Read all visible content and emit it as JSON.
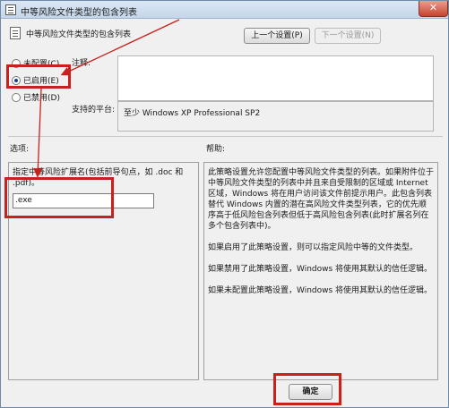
{
  "window": {
    "title": "中等风险文件类型的包含列表",
    "close": "✕"
  },
  "header": {
    "title": "中等风险文件类型的包含列表",
    "prev_button": "上一个设置(P)",
    "next_button": "下一个设置(N)"
  },
  "state_options": [
    {
      "label": "未配置(C)",
      "checked": false
    },
    {
      "label": "已启用(E)",
      "checked": true
    },
    {
      "label": "已禁用(D)",
      "checked": false
    }
  ],
  "comment_label": "注释:",
  "platform": {
    "label": "支持的平台:",
    "value": "至少 Windows XP Professional SP2"
  },
  "options": {
    "label": "选项:",
    "description": "指定中等风险扩展名(包括前导句点，如 .doc 和 .pdf)。",
    "extension_value": ".exe"
  },
  "help": {
    "label": "帮助:",
    "paragraphs": [
      "此策略设置允许您配置中等风险文件类型的列表。如果附件位于中等风险文件类型的列表中并且来自受限制的区域或 Internet 区域，Windows 将在用户访问该文件前提示用户。此包含列表替代 Windows 内置的潜在高风险文件类型列表，它的优先顺序高于低风险包含列表但低于高风险包含列表(此时扩展名列在多个包含列表中)。",
      "如果启用了此策略设置，则可以指定风险中等的文件类型。",
      "如果禁用了此策略设置，Windows 将使用其默认的信任逻辑。",
      "如果未配置此策略设置，Windows 将使用其默认的信任逻辑。"
    ]
  },
  "footer": {
    "ok_button": "确定"
  },
  "colors": {
    "highlight": "#c8201c"
  }
}
